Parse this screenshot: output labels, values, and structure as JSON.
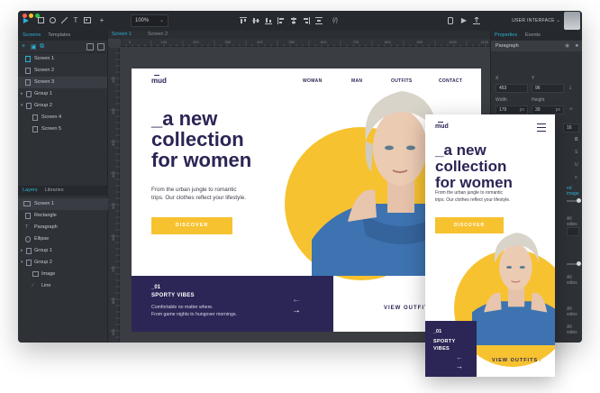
{
  "toolbar": {
    "zoom": "100%",
    "mode_label": "USER INTERFACE",
    "mode_caret": "⌄"
  },
  "left_panel": {
    "tabs": [
      "Screens",
      "Templates"
    ],
    "screens": [
      {
        "label": "Screen 1"
      },
      {
        "label": "Screen 2"
      },
      {
        "label": "Screen 3"
      },
      {
        "label": "Group 1"
      },
      {
        "label": "Group 2"
      },
      {
        "label": "Screen 4"
      },
      {
        "label": "Screen 5"
      }
    ],
    "layer_tabs": [
      "Layers",
      "Libraries"
    ],
    "layers": [
      {
        "label": "Screen 1"
      },
      {
        "label": "Rectangle"
      },
      {
        "label": "Paragraph"
      },
      {
        "label": "Ellipse"
      },
      {
        "label": "Group 1"
      },
      {
        "label": "Group 2"
      },
      {
        "label": "Image"
      },
      {
        "label": "Line"
      }
    ]
  },
  "canvas": {
    "tabs": [
      "Screen 1",
      "Screen 2"
    ],
    "ruler_h": [
      "0",
      "100",
      "200",
      "300",
      "400",
      "500",
      "600",
      "700",
      "800",
      "900",
      "1000",
      "1100"
    ],
    "ruler_v": [
      "100",
      "200",
      "300",
      "400",
      "500",
      "600",
      "700",
      "800",
      "900"
    ]
  },
  "right_panel": {
    "tabs": [
      "Properties",
      "Events"
    ],
    "element": "Paragraph",
    "x_label": "X",
    "y_label": "Y",
    "x_value": "453",
    "y_value": "96",
    "width_label": "Width",
    "height_label": "Height",
    "width_value": "179",
    "width_unit": "px",
    "height_value": "39",
    "height_unit": "px",
    "font_size": "16",
    "link_text": "ed image",
    "all_sides_1": "All sides",
    "all_sides_2": "All sides",
    "all_sides_3": "All sides",
    "all_sides_4": "All sides"
  },
  "desktop": {
    "logo": "mud",
    "nav": [
      "WOMAN",
      "MAN",
      "OUTFITS",
      "CONTACT"
    ],
    "headline": [
      "_a new",
      "collection",
      "for women"
    ],
    "subtext": [
      "From the urban jungle to romantic",
      "trips. Our clothes reflect your lifestyle."
    ],
    "button": "DISCOVER",
    "promo_num": "_01",
    "promo_title": "SPORTY VIBES",
    "promo_text": [
      "Comfortable no matter where.",
      "From game nights to hungover mornings."
    ],
    "outfits": "VIEW OUTFITS"
  },
  "mobile": {
    "logo": "mud",
    "headline": [
      "_a new",
      "collection",
      "for women"
    ],
    "subtext": [
      "From the urban jungle to romantic",
      "trips. Our clothes reflect your lifestyle."
    ],
    "button": "DISCOVER",
    "promo_num": "_01",
    "promo_title": [
      "SPORTY",
      "VIBES"
    ],
    "outfits": "VIEW OUTFITS",
    "outfits_arrow": "›"
  },
  "colors": {
    "accent": "#2db1d5",
    "navy": "#2c2656",
    "yellow": "#f7c230",
    "sweater": "#3d73b1"
  }
}
